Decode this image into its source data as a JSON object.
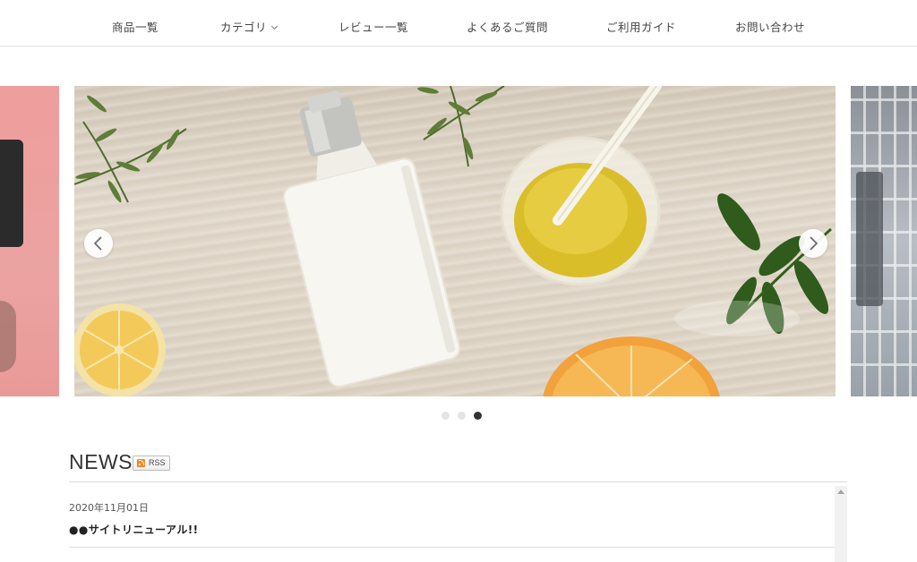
{
  "nav": {
    "items": [
      {
        "label": "商品一覧"
      },
      {
        "label": "カテゴリ"
      },
      {
        "label": "レビュー一覧"
      },
      {
        "label": "よくあるご質問"
      },
      {
        "label": "ご利用ガイド"
      },
      {
        "label": "お問い合わせ"
      }
    ]
  },
  "slider": {
    "total_slides": 3,
    "active_slide": 3
  },
  "news": {
    "title": "NEWS",
    "rss_label": "RSS",
    "items": [
      {
        "date": "2020年11月01日",
        "headline": "●●サイトリニューアル!!"
      }
    ]
  }
}
